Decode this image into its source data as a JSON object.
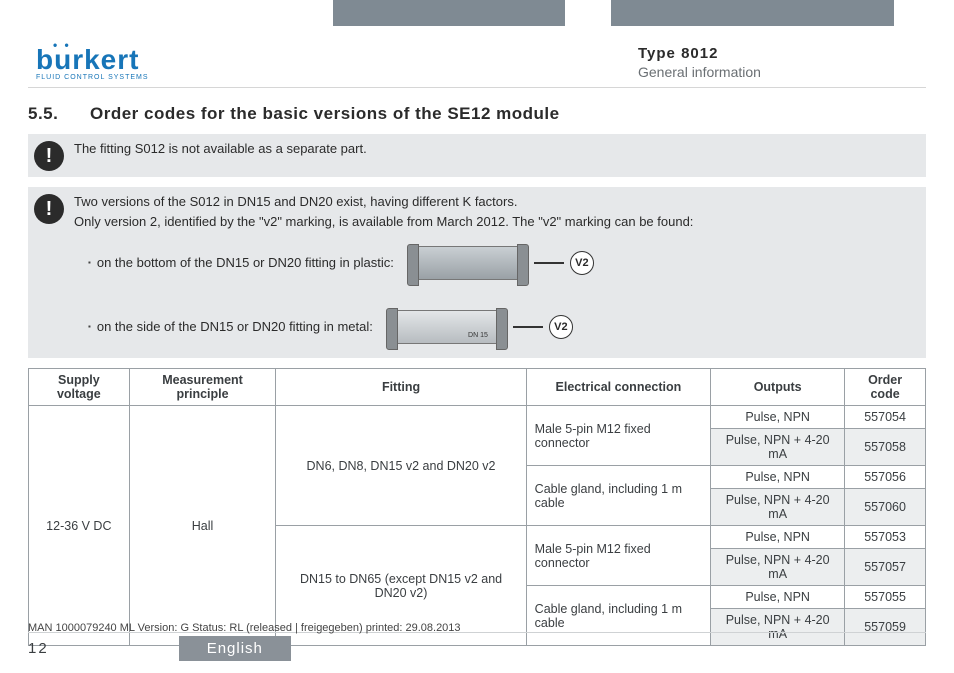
{
  "header": {
    "logo_main": "burkert",
    "logo_sub": "FLUID CONTROL SYSTEMS",
    "type_label": "Type 8012",
    "subtitle": "General information"
  },
  "section": {
    "number": "5.5.",
    "title": "Order codes for the basic versions of the SE12 module"
  },
  "note1": "The fitting S012 is not available as a separate part.",
  "note2": {
    "line1": "Two versions of the S012 in DN15 and DN20 exist, having different K factors.",
    "line2": "Only version 2, identified by the \"v2\" marking, is available from March 2012. The \"v2\" marking can be found:",
    "bullet1": "on the bottom of the DN15 or DN20 fitting in plastic:",
    "bullet2": "on the side of the DN15 or DN20 fitting in metal:",
    "v2": "V2",
    "dn_label": "DN 15"
  },
  "table": {
    "headers": {
      "supply": "Supply voltage",
      "principle": "Measurement principle",
      "fitting": "Fitting",
      "conn": "Electrical connection",
      "outputs": "Outputs",
      "code": "Order code"
    },
    "supply_value": "12-36 V DC",
    "principle_value": "Hall",
    "fitting_a": "DN6, DN8, DN15 v2 and DN20 v2",
    "fitting_b": "DN15 to DN65 (except DN15 v2 and DN20 v2)",
    "conn_a": "Male 5-pin M12 fixed connector",
    "conn_b": "Cable gland, including 1 m cable",
    "rows": [
      {
        "outputs": "Pulse, NPN",
        "code": "557054"
      },
      {
        "outputs": "Pulse, NPN + 4-20 mA",
        "code": "557058"
      },
      {
        "outputs": "Pulse, NPN",
        "code": "557056"
      },
      {
        "outputs": "Pulse, NPN + 4-20 mA",
        "code": "557060"
      },
      {
        "outputs": "Pulse, NPN",
        "code": "557053"
      },
      {
        "outputs": "Pulse, NPN + 4-20 mA",
        "code": "557057"
      },
      {
        "outputs": "Pulse, NPN",
        "code": "557055"
      },
      {
        "outputs": "Pulse, NPN + 4-20 mA",
        "code": "557059"
      }
    ]
  },
  "footer": {
    "meta": "MAN 1000079240 ML Version: G Status: RL (released | freigegeben) printed: 29.08.2013",
    "page": "12",
    "language": "English"
  }
}
